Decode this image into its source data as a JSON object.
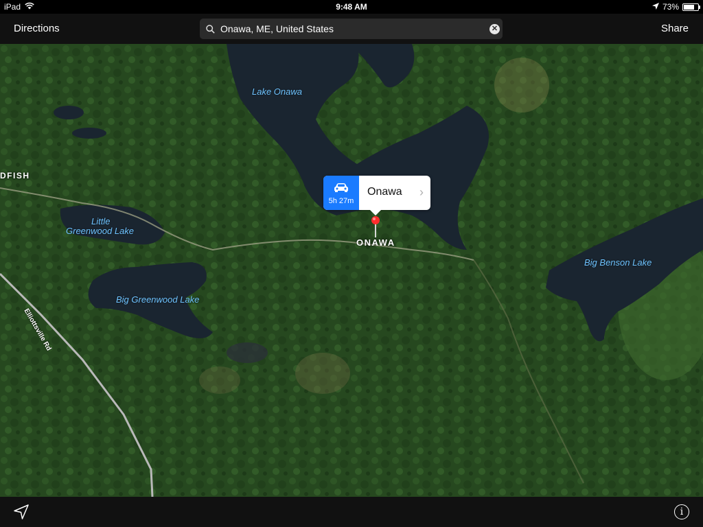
{
  "status_bar": {
    "device": "iPad",
    "time": "9:48 AM",
    "battery_text": "73%",
    "battery_level": 0.73,
    "icons": [
      "wifi-icon",
      "location-arrow-icon",
      "battery-icon"
    ]
  },
  "navbar": {
    "directions_label": "Directions",
    "share_label": "Share",
    "search_value": "Onawa, ME, United States",
    "search_icon": "magnifier-icon",
    "clear_icon": "clear-x-icon"
  },
  "map": {
    "style": "satellite",
    "lake_labels": {
      "lake_onawa": "Lake Onawa",
      "little_greenwood_1": "Little",
      "little_greenwood_2": "Greenwood Lake",
      "big_greenwood": "Big Greenwood Lake",
      "big_benson": "Big Benson Lake"
    },
    "place_labels": {
      "onawa": "ONAWA",
      "dfish": "DFISH"
    },
    "road_labels": {
      "elliottsville": "Elliottsville Rd"
    }
  },
  "callout": {
    "title": "Onawa",
    "eta": "5h 27m",
    "drive_icon": "car-icon",
    "disclosure_icon": "chevron-right-icon"
  },
  "bottombar": {
    "locate_icon": "location-arrow-icon",
    "info_icon": "info-icon",
    "info_glyph": "i"
  },
  "colors": {
    "accent": "#1a7bff",
    "pin": "#ff2d2d",
    "water_label": "#6ec3ff",
    "bar_background": "#111111"
  }
}
